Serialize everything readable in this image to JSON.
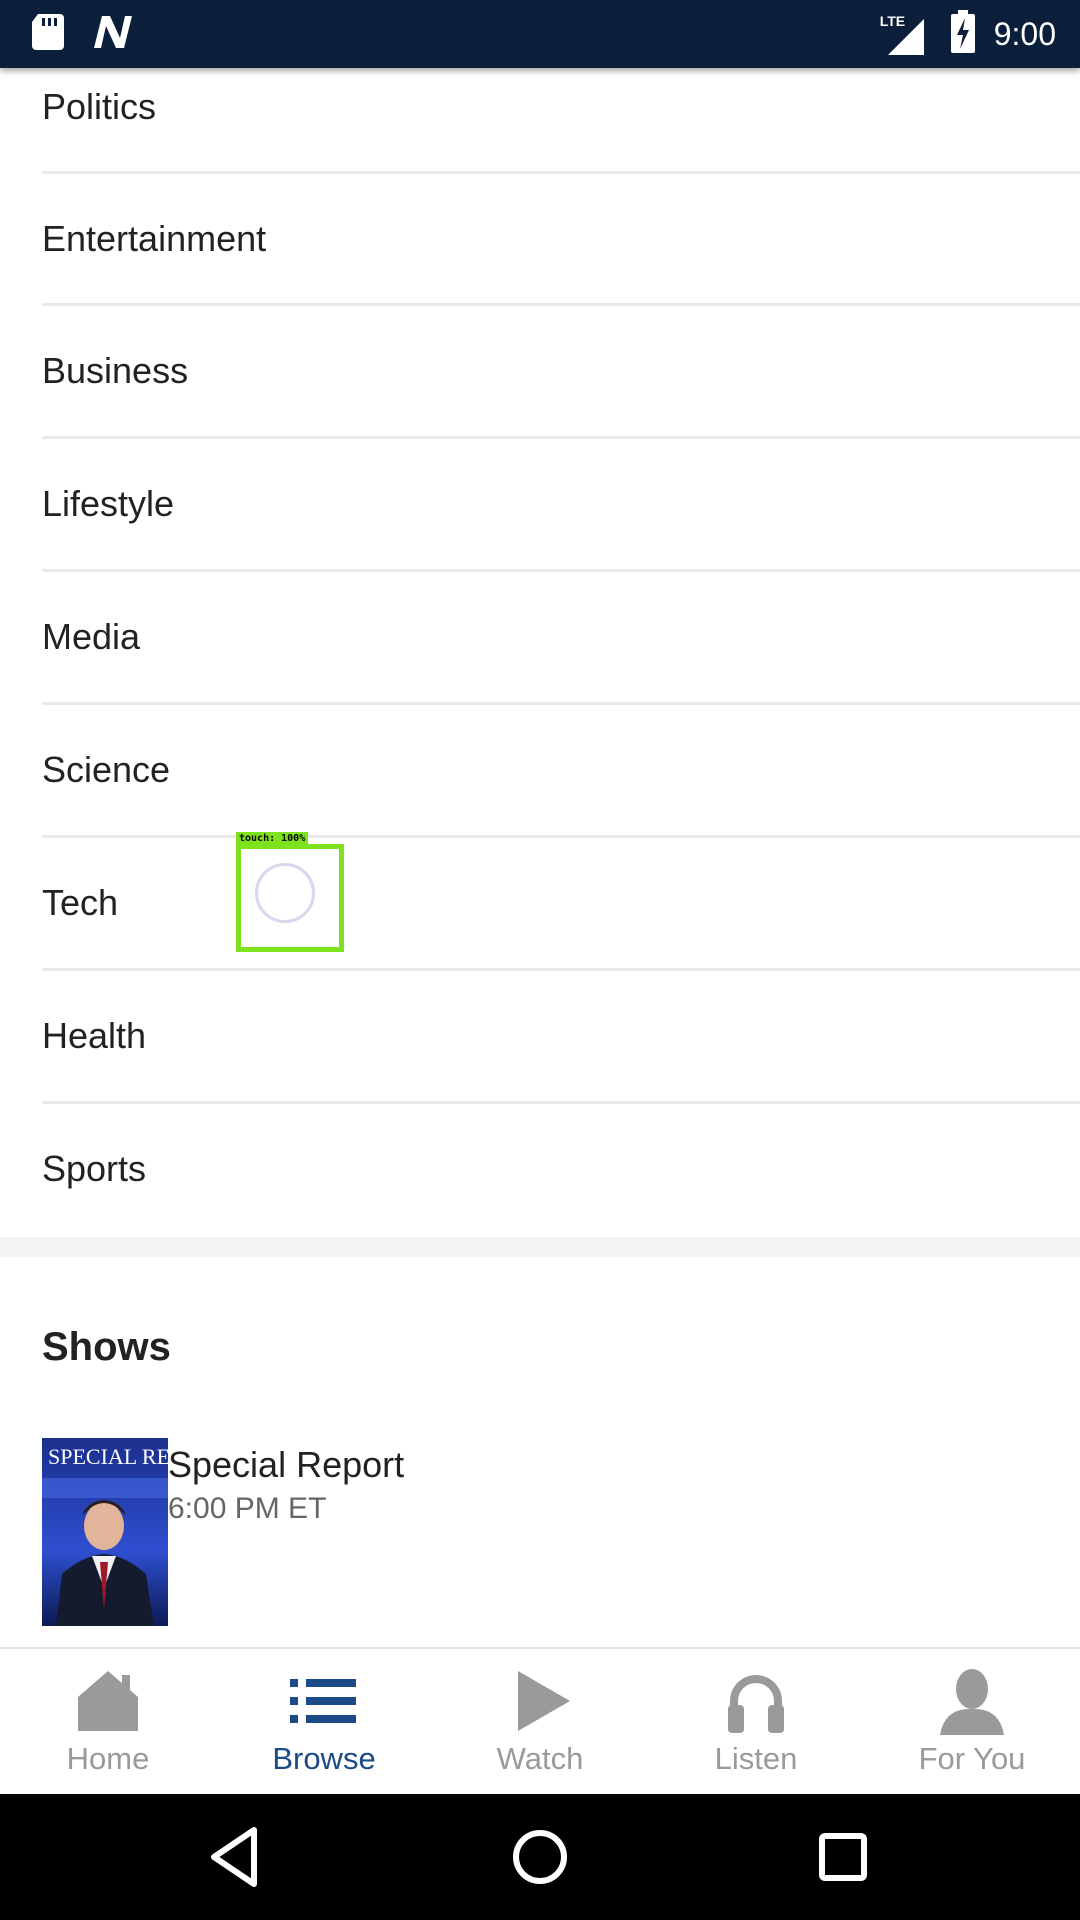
{
  "status_bar": {
    "time": "9:00",
    "network": "LTE",
    "icons": [
      "sd-card-icon",
      "n-notification-icon",
      "signal-icon",
      "battery-charging-icon"
    ]
  },
  "categories": [
    {
      "label": "Politics"
    },
    {
      "label": "Entertainment"
    },
    {
      "label": "Business"
    },
    {
      "label": "Lifestyle"
    },
    {
      "label": "Media"
    },
    {
      "label": "Science"
    },
    {
      "label": "Tech"
    },
    {
      "label": "Health"
    },
    {
      "label": "Sports"
    }
  ],
  "shows": {
    "title": "Shows",
    "items": [
      {
        "name": "Special Report",
        "time": "6:00 PM ET",
        "thumb_icon": "show-poster-image",
        "thumb_text": "SPECIAL REPORT"
      }
    ]
  },
  "touch_overlay": {
    "label": "touch: 100%"
  },
  "bottom_nav": {
    "items": [
      {
        "label": "Home",
        "icon": "home-icon",
        "active": false
      },
      {
        "label": "Browse",
        "icon": "list-icon",
        "active": true
      },
      {
        "label": "Watch",
        "icon": "play-icon",
        "active": false
      },
      {
        "label": "Listen",
        "icon": "headphones-icon",
        "active": false
      },
      {
        "label": "For You",
        "icon": "person-icon",
        "active": false
      }
    ]
  },
  "system_nav": {
    "icons": [
      "back-icon",
      "home-circle-icon",
      "recents-icon"
    ]
  },
  "colors": {
    "status_bar": "#0b1f3a",
    "active_nav": "#1c4a86",
    "inactive_nav": "#9a9a9a",
    "touch_box": "#7ee31c"
  }
}
